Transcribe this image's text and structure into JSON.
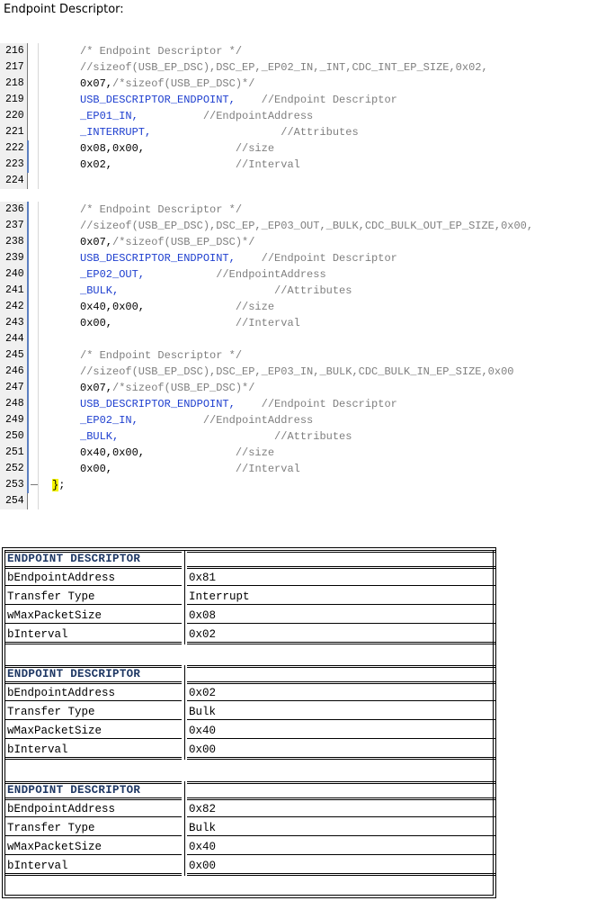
{
  "heading": "Endpoint Descriptor:",
  "code_block_1": [
    {
      "n": "216",
      "t": "/* Endpoint Descriptor */",
      "c": "cm"
    },
    {
      "n": "217",
      "t": "//sizeof(USB_EP_DSC),DSC_EP,_EP02_IN,_INT,CDC_INT_EP_SIZE,0x02,",
      "c": "cm"
    },
    {
      "n": "218",
      "t": "0x07,",
      "t2": "/*sizeof(USB_EP_DSC)*/",
      "c": ""
    },
    {
      "n": "219",
      "t": "USB_DESCRIPTOR_ENDPOINT,",
      "t2": "    //Endpoint Descriptor",
      "c": "kw"
    },
    {
      "n": "220",
      "t": "_EP01_IN,",
      "t2": "          //EndpointAddress",
      "c": "kw"
    },
    {
      "n": "221",
      "t": "_INTERRUPT,",
      "t2": "                    //Attributes",
      "c": "kw"
    },
    {
      "n": "222",
      "t": "0x08,0x00,",
      "t2": "              //size",
      "c": ""
    },
    {
      "n": "223",
      "t": "0x02,",
      "t2": "                   //Interval",
      "c": ""
    },
    {
      "n": "224",
      "t": "",
      "c": ""
    }
  ],
  "code_block_2": [
    {
      "n": "236",
      "t": "/* Endpoint Descriptor */",
      "c": "cm"
    },
    {
      "n": "237",
      "t": "//sizeof(USB_EP_DSC),DSC_EP,_EP03_OUT,_BULK,CDC_BULK_OUT_EP_SIZE,0x00,",
      "c": "cm"
    },
    {
      "n": "238",
      "t": "0x07,",
      "t2": "/*sizeof(USB_EP_DSC)*/",
      "c": ""
    },
    {
      "n": "239",
      "t": "USB_DESCRIPTOR_ENDPOINT,",
      "t2": "    //Endpoint Descriptor",
      "c": "kw"
    },
    {
      "n": "240",
      "t": "_EP02_OUT,",
      "t2": "           //EndpointAddress",
      "c": "kw"
    },
    {
      "n": "241",
      "t": "_BULK,",
      "t2": "                        //Attributes",
      "c": "kw"
    },
    {
      "n": "242",
      "t": "0x40,0x00,",
      "t2": "              //size",
      "c": ""
    },
    {
      "n": "243",
      "t": "0x00,",
      "t2": "                   //Interval",
      "c": ""
    },
    {
      "n": "244",
      "t": "",
      "c": ""
    },
    {
      "n": "245",
      "t": "/* Endpoint Descriptor */",
      "c": "cm"
    },
    {
      "n": "246",
      "t": "//sizeof(USB_EP_DSC),DSC_EP,_EP03_IN,_BULK,CDC_BULK_IN_EP_SIZE,0x00",
      "c": "cm"
    },
    {
      "n": "247",
      "t": "0x07,",
      "t2": "/*sizeof(USB_EP_DSC)*/",
      "c": ""
    },
    {
      "n": "248",
      "t": "USB_DESCRIPTOR_ENDPOINT,",
      "t2": "    //Endpoint Descriptor",
      "c": "kw"
    },
    {
      "n": "249",
      "t": "_EP02_IN,",
      "t2": "          //EndpointAddress",
      "c": "kw"
    },
    {
      "n": "250",
      "t": "_BULK,",
      "t2": "                        //Attributes",
      "c": "kw"
    },
    {
      "n": "251",
      "t": "0x40,0x00,",
      "t2": "              //size",
      "c": ""
    },
    {
      "n": "252",
      "t": "0x00,",
      "t2": "                   //Interval",
      "c": ""
    },
    {
      "n": "253",
      "t": "};",
      "c": "brace"
    },
    {
      "n": "254",
      "t": "",
      "c": ""
    }
  ],
  "descriptors": [
    {
      "title": "ENDPOINT DESCRIPTOR",
      "rows": [
        {
          "k": "bEndpointAddress",
          "v": "0x81"
        },
        {
          "k": "Transfer Type",
          "v": "Interrupt"
        },
        {
          "k": "wMaxPacketSize",
          "v": "0x08"
        },
        {
          "k": "bInterval",
          "v": "0x02"
        }
      ]
    },
    {
      "title": "ENDPOINT DESCRIPTOR",
      "rows": [
        {
          "k": "bEndpointAddress",
          "v": "0x02"
        },
        {
          "k": "Transfer Type",
          "v": "Bulk"
        },
        {
          "k": "wMaxPacketSize",
          "v": "0x40"
        },
        {
          "k": "bInterval",
          "v": "0x00"
        }
      ]
    },
    {
      "title": "ENDPOINT DESCRIPTOR",
      "rows": [
        {
          "k": "bEndpointAddress",
          "v": "0x82"
        },
        {
          "k": "Transfer Type",
          "v": "Bulk"
        },
        {
          "k": "wMaxPacketSize",
          "v": "0x40"
        },
        {
          "k": "bInterval",
          "v": "0x00"
        }
      ]
    }
  ]
}
